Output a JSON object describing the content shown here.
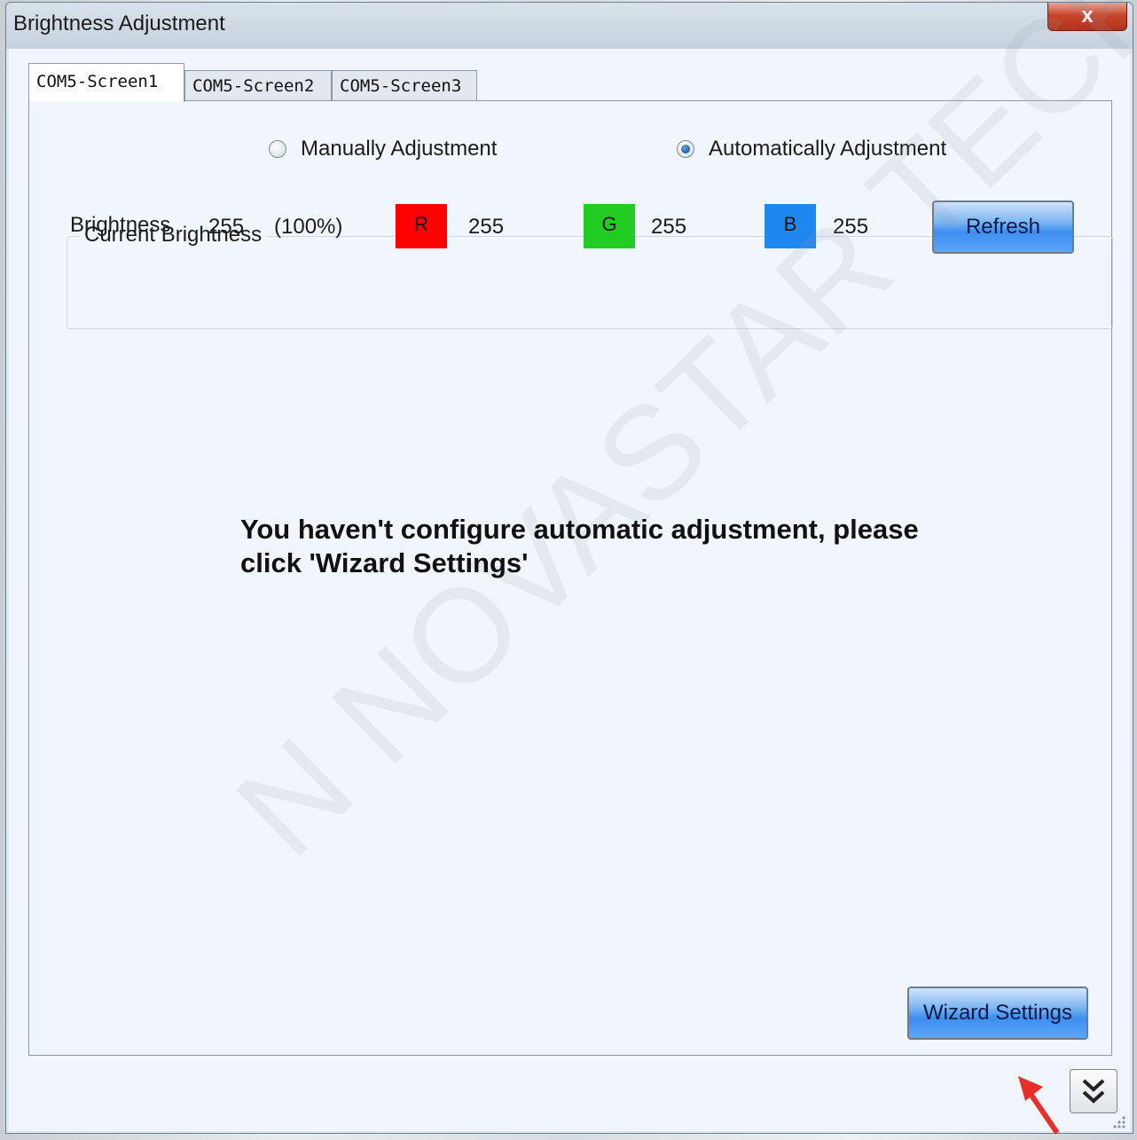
{
  "window": {
    "title": "Brightness Adjustment",
    "close_label": "x"
  },
  "tabs": [
    {
      "label": "COM5-Screen1",
      "active": true
    },
    {
      "label": "COM5-Screen2",
      "active": false
    },
    {
      "label": "COM5-Screen3",
      "active": false
    }
  ],
  "mode": {
    "manual_label": "Manually Adjustment",
    "auto_label": "Automatically Adjustment",
    "selected": "auto"
  },
  "current": {
    "group_label": "Current Brightness",
    "brightness_label": "Brightness",
    "brightness_value": "255",
    "brightness_percent": "(100%)",
    "r_label": "R",
    "r_value": "255",
    "r_color": "#ff0000",
    "g_label": "G",
    "g_value": "255",
    "g_color": "#22cc22",
    "b_label": "B",
    "b_value": "255",
    "b_color": "#1e88f0",
    "refresh_label": "Refresh"
  },
  "message": {
    "line1": "You haven't configure automatic adjustment, please",
    "line2": "click 'Wizard Settings'"
  },
  "wizard_label": "Wizard Settings",
  "watermark": "N NOVASTAR TECH CO., L",
  "colors": {
    "accent": "#3d8ef0",
    "annotation_arrow": "#e8302a"
  }
}
